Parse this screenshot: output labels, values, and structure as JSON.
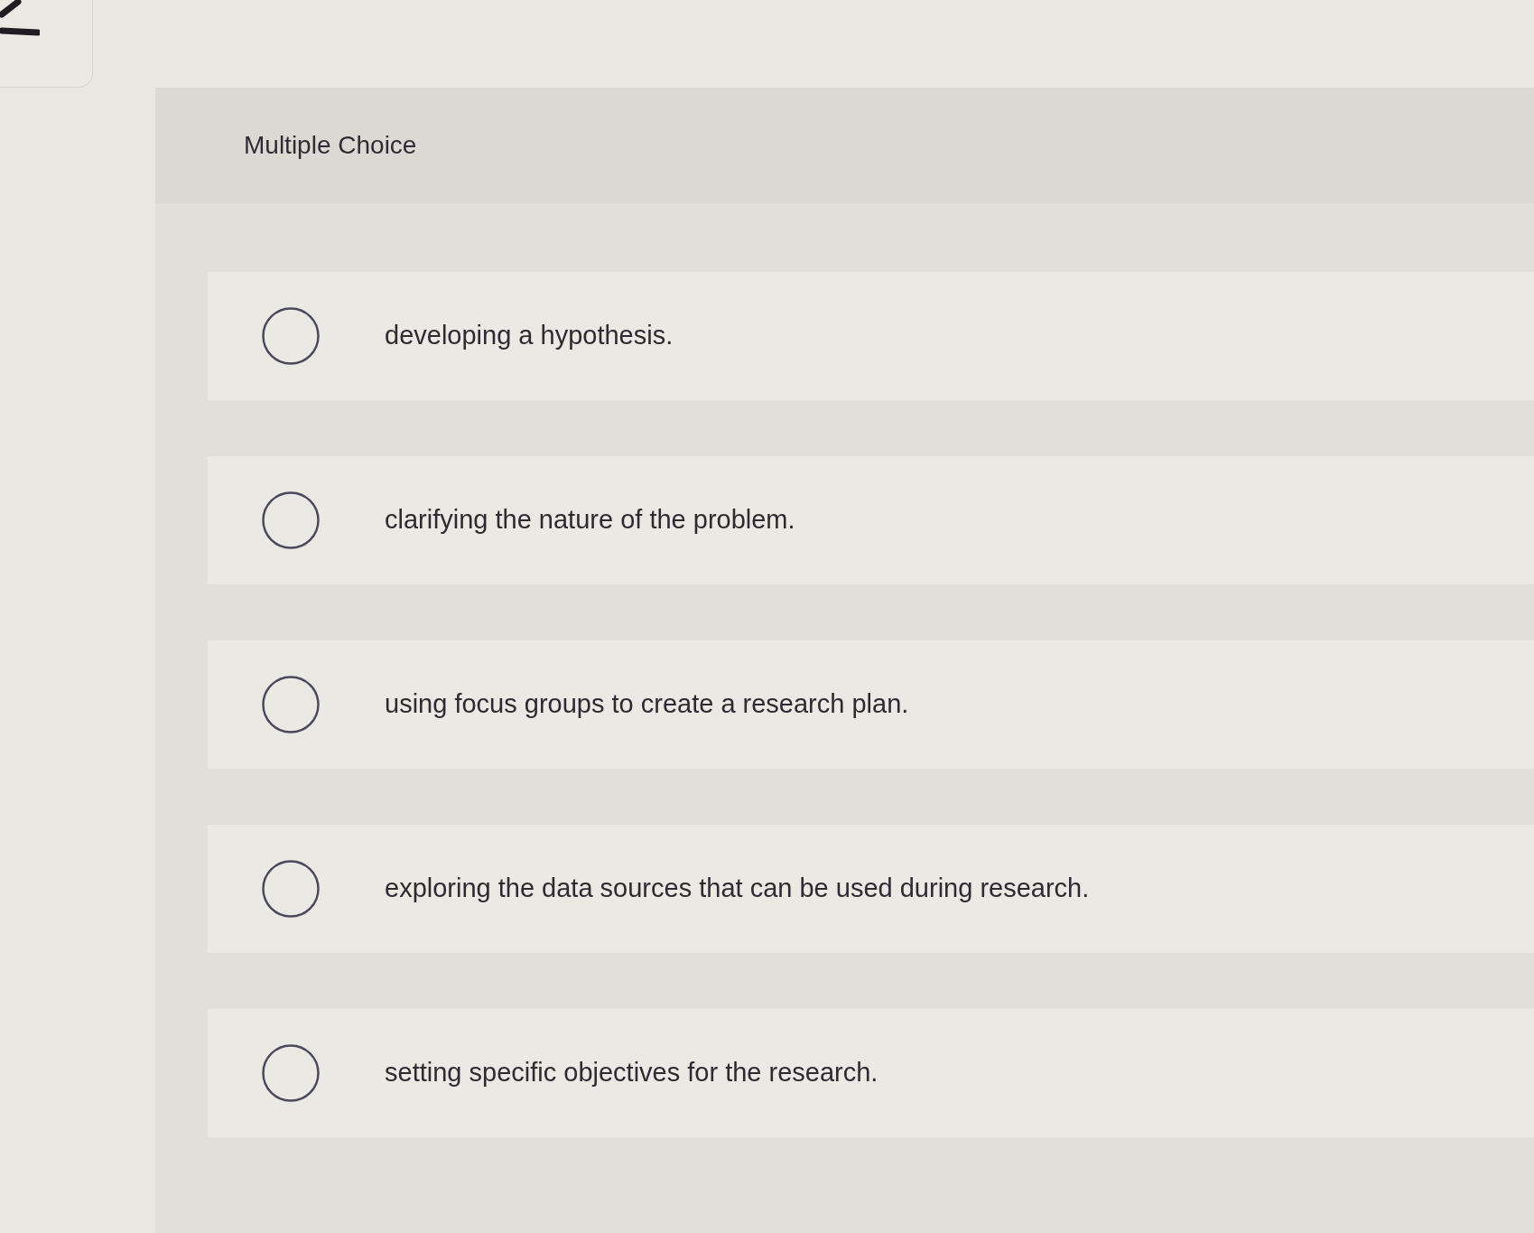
{
  "question": {
    "type_label": "Multiple Choice",
    "options": [
      {
        "text": "developing a hypothesis.",
        "selected": false
      },
      {
        "text": "clarifying the nature of the problem.",
        "selected": false
      },
      {
        "text": "using focus groups to create a research plan.",
        "selected": false
      },
      {
        "text": "exploring the data sources that can be used during research.",
        "selected": false
      },
      {
        "text": "setting specific objectives for the research.",
        "selected": false
      }
    ]
  }
}
